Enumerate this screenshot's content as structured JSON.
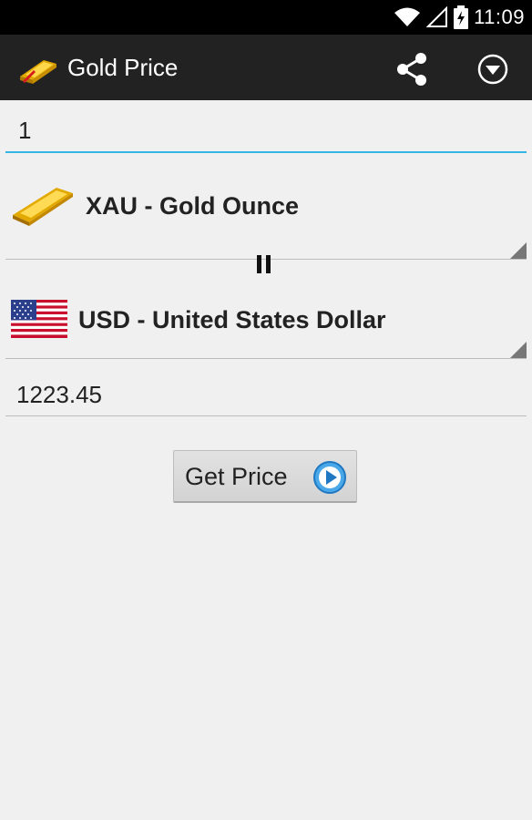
{
  "status_bar": {
    "time": "11:09"
  },
  "action_bar": {
    "title": "Gold Price",
    "icons": [
      "gold-bar-icon",
      "share-icon",
      "overflow-menu-icon"
    ]
  },
  "amount_input": {
    "value": "1"
  },
  "from_currency": {
    "label": "XAU - Gold Ounce",
    "icon": "gold-bar-icon"
  },
  "to_currency": {
    "label": "USD - United States Dollar",
    "icon": "us-flag-icon"
  },
  "result": {
    "value": "1223.45"
  },
  "get_price_button": {
    "label": "Get Price",
    "icon": "play-icon"
  },
  "colors": {
    "accent": "#33b5e5",
    "action_bar": "#222222",
    "background": "#f0f0f0"
  }
}
